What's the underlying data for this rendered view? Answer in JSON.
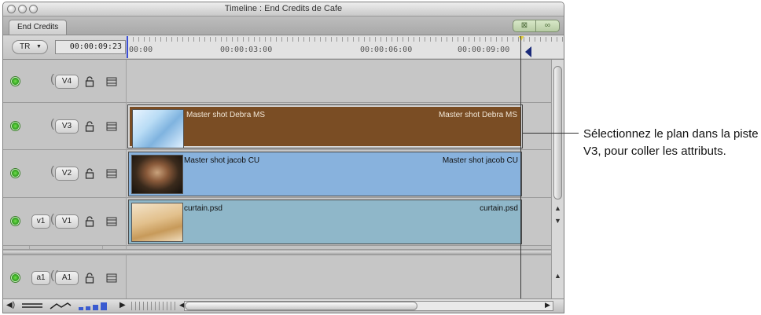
{
  "window": {
    "title": "Timeline : End Credits de Cafe"
  },
  "tabbar": {
    "sequence_tab": "End Credits",
    "snapping_icon": "snapping-icon",
    "linking_icon": "linking-icon"
  },
  "ruler": {
    "track_popup_label": "TR",
    "current_timecode": "00:00:09:23",
    "labels": [
      "00:00",
      "00:00:03:00",
      "00:00:06:00",
      "00:00:09:00"
    ]
  },
  "tracks": {
    "video": [
      {
        "dest": "V4",
        "source": "",
        "clip": null
      },
      {
        "dest": "V3",
        "source": "",
        "clip": {
          "name": "Master shot Debra MS",
          "selected": true
        }
      },
      {
        "dest": "V2",
        "source": "",
        "clip": {
          "name": "Master shot jacob CU",
          "selected": false
        }
      },
      {
        "dest": "V1",
        "source": "v1",
        "clip": {
          "name": "curtain.psd",
          "selected": false
        }
      }
    ],
    "audio": [
      {
        "dest": "A1",
        "source": "a1"
      }
    ]
  },
  "colors": {
    "selected_clip": "#7a4d24",
    "video_clip": "#88b2dd",
    "still_clip": "#8fb7c9",
    "track_enable": "#2f9a1e",
    "playhead": "#e8d23a"
  },
  "callout": {
    "text": "Sélectionnez le plan dans la piste V3, pour coller les attributs."
  }
}
